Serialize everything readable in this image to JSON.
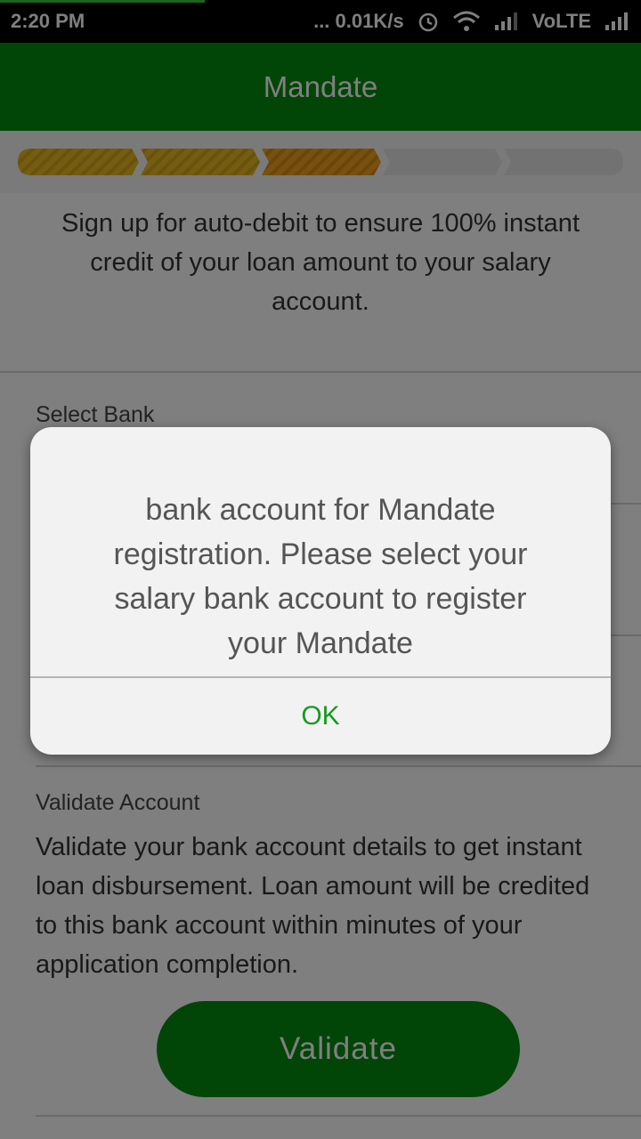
{
  "status_bar": {
    "time": "2:20 PM",
    "network_speed": "... 0.01K/s",
    "volte": "VoLTE"
  },
  "app_bar": {
    "title": "Mandate"
  },
  "progress": {
    "total_steps": 5,
    "completed_steps": 3
  },
  "intro_text": "Sign up for auto-debit to ensure 100% instant credit of your loan amount to your salary account.",
  "select_bank": {
    "label": "Select Bank"
  },
  "validate_account": {
    "label": "Validate Account",
    "description": "Validate your bank account details to get instant loan disbursement. Loan amount will be credited to this bank account within minutes of your application completion.",
    "button_label": "Validate"
  },
  "dialog": {
    "message": "bank account for Mandate registration. Please select your salary bank account to register your Mandate",
    "ok_label": "OK"
  },
  "colors": {
    "brand_green": "#028b0f",
    "step_yellow": "#e8b923",
    "step_orange": "#f0a21e",
    "step_empty": "#e4e4e4"
  }
}
